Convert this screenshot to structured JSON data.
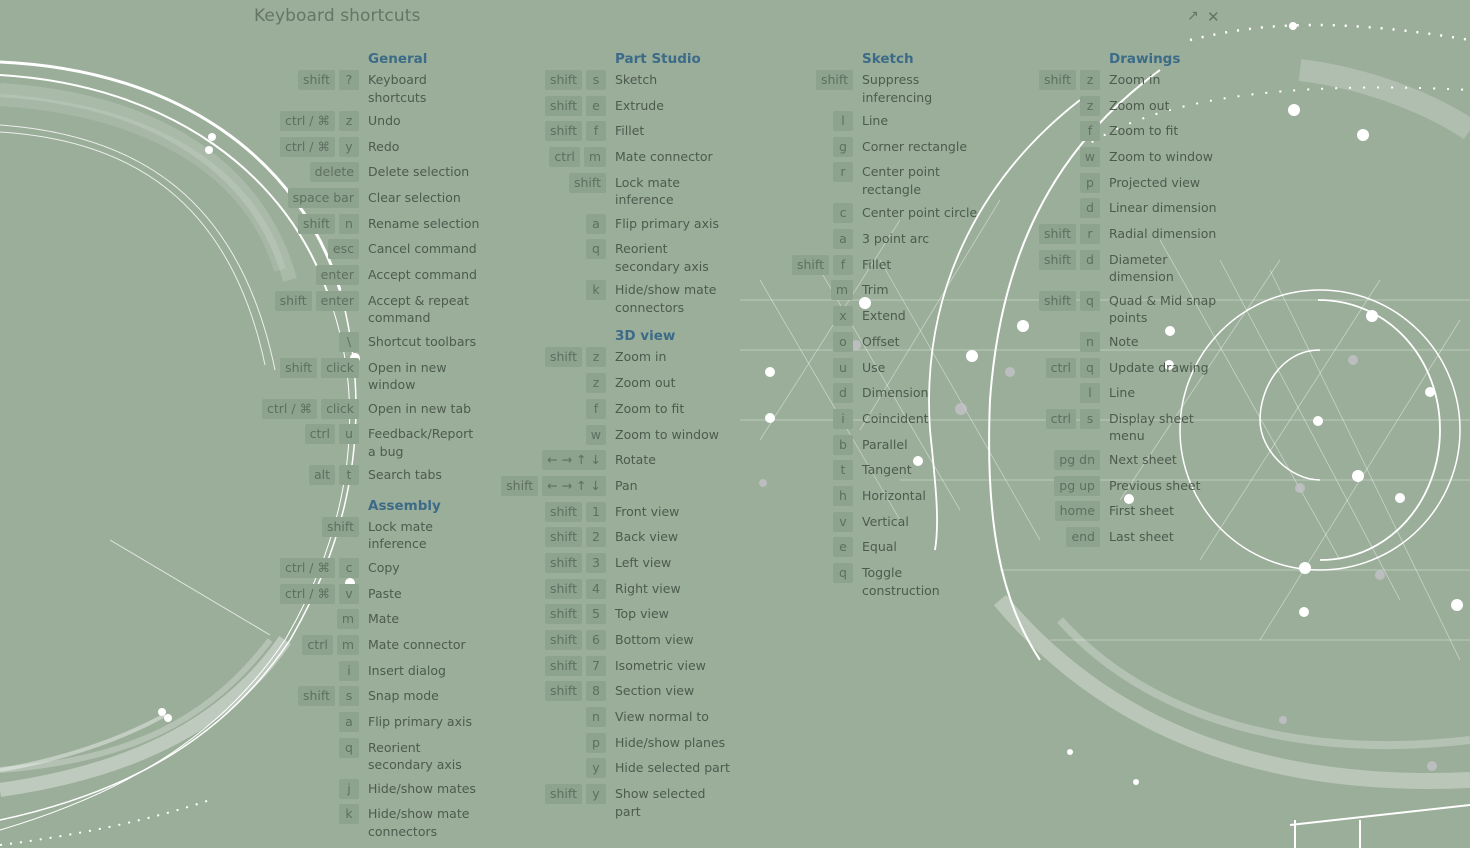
{
  "window": {
    "title": "Keyboard shortcuts",
    "expand_icon": "↗",
    "close_icon": "✕"
  },
  "colors": {
    "background": "#9bae9a",
    "section_title": "#3c6b88",
    "key_bg": "#8da38e",
    "text": "#4d5b4d"
  },
  "columns": [
    {
      "sections": [
        {
          "title": "General",
          "items": [
            {
              "keys": [
                "shift",
                "?"
              ],
              "label": "Keyboard shortcuts",
              "lines": 2
            },
            {
              "keys": [
                "ctrl / ⌘",
                "z"
              ],
              "label": "Undo"
            },
            {
              "keys": [
                "ctrl / ⌘",
                "y"
              ],
              "label": "Redo"
            },
            {
              "keys": [
                "delete"
              ],
              "label": "Delete selection"
            },
            {
              "keys": [
                "space bar"
              ],
              "label": "Clear selection"
            },
            {
              "keys": [
                "shift",
                "n"
              ],
              "label": "Rename selection"
            },
            {
              "keys": [
                "esc"
              ],
              "label": "Cancel command"
            },
            {
              "keys": [
                "enter"
              ],
              "label": "Accept command"
            },
            {
              "keys": [
                "shift",
                "enter"
              ],
              "label": "Accept & repeat command",
              "lines": 2
            },
            {
              "keys": [
                "\\"
              ],
              "label": "Shortcut toolbars"
            },
            {
              "keys": [
                "shift",
                "click"
              ],
              "label": "Open in new window",
              "lines": 2
            },
            {
              "keys": [
                "ctrl / ⌘",
                "click"
              ],
              "label": "Open in new tab"
            },
            {
              "keys": [
                "ctrl",
                "u"
              ],
              "label": "Feedback/Report a bug",
              "lines": 2
            },
            {
              "keys": [
                "alt",
                "t"
              ],
              "label": "Search tabs"
            }
          ]
        },
        {
          "title": "Assembly",
          "items": [
            {
              "keys": [
                "shift"
              ],
              "label": "Lock mate inference",
              "lines": 2
            },
            {
              "keys": [
                "ctrl / ⌘",
                "c"
              ],
              "label": "Copy"
            },
            {
              "keys": [
                "ctrl / ⌘",
                "v"
              ],
              "label": "Paste"
            },
            {
              "keys": [
                "m"
              ],
              "label": "Mate"
            },
            {
              "keys": [
                "ctrl",
                "m"
              ],
              "label": "Mate connector"
            },
            {
              "keys": [
                "i"
              ],
              "label": "Insert dialog"
            },
            {
              "keys": [
                "shift",
                "s"
              ],
              "label": "Snap mode"
            },
            {
              "keys": [
                "a"
              ],
              "label": "Flip primary axis"
            },
            {
              "keys": [
                "q"
              ],
              "label": "Reorient secondary axis",
              "lines": 2
            },
            {
              "keys": [
                "j"
              ],
              "label": "Hide/show mates"
            },
            {
              "keys": [
                "k"
              ],
              "label": "Hide/show mate connectors",
              "lines": 2
            }
          ]
        }
      ]
    },
    {
      "sections": [
        {
          "title": "Part Studio",
          "items": [
            {
              "keys": [
                "shift",
                "s"
              ],
              "label": "Sketch"
            },
            {
              "keys": [
                "shift",
                "e"
              ],
              "label": "Extrude"
            },
            {
              "keys": [
                "shift",
                "f"
              ],
              "label": "Fillet"
            },
            {
              "keys": [
                "ctrl",
                "m"
              ],
              "label": "Mate connector"
            },
            {
              "keys": [
                "shift"
              ],
              "label": "Lock mate inference",
              "lines": 2
            },
            {
              "keys": [
                "a"
              ],
              "label": "Flip primary axis"
            },
            {
              "keys": [
                "q"
              ],
              "label": "Reorient secondary axis",
              "lines": 2
            },
            {
              "keys": [
                "k"
              ],
              "label": "Hide/show mate connectors",
              "lines": 2
            }
          ]
        },
        {
          "title": "3D view",
          "items": [
            {
              "keys": [
                "shift",
                "z"
              ],
              "label": "Zoom in"
            },
            {
              "keys": [
                "z"
              ],
              "label": "Zoom out"
            },
            {
              "keys": [
                "f"
              ],
              "label": "Zoom to fit"
            },
            {
              "keys": [
                "w"
              ],
              "label": "Zoom to window"
            },
            {
              "keys": [
                "← → ↑ ↓"
              ],
              "label": "Rotate"
            },
            {
              "keys": [
                "shift",
                "← → ↑ ↓"
              ],
              "label": "Pan"
            },
            {
              "keys": [
                "shift",
                "1"
              ],
              "label": "Front view"
            },
            {
              "keys": [
                "shift",
                "2"
              ],
              "label": "Back view"
            },
            {
              "keys": [
                "shift",
                "3"
              ],
              "label": "Left view"
            },
            {
              "keys": [
                "shift",
                "4"
              ],
              "label": "Right view"
            },
            {
              "keys": [
                "shift",
                "5"
              ],
              "label": "Top view"
            },
            {
              "keys": [
                "shift",
                "6"
              ],
              "label": "Bottom view"
            },
            {
              "keys": [
                "shift",
                "7"
              ],
              "label": "Isometric view"
            },
            {
              "keys": [
                "shift",
                "8"
              ],
              "label": "Section view"
            },
            {
              "keys": [
                "n"
              ],
              "label": "View normal to"
            },
            {
              "keys": [
                "p"
              ],
              "label": "Hide/show planes"
            },
            {
              "keys": [
                "y"
              ],
              "label": "Hide selected part"
            },
            {
              "keys": [
                "shift",
                "y"
              ],
              "label": "Show selected part",
              "lines": 2
            }
          ]
        }
      ]
    },
    {
      "sections": [
        {
          "title": "Sketch",
          "items": [
            {
              "keys": [
                "shift"
              ],
              "label": "Suppress inferencing",
              "lines": 2
            },
            {
              "keys": [
                "l"
              ],
              "label": "Line"
            },
            {
              "keys": [
                "g"
              ],
              "label": "Corner rectangle"
            },
            {
              "keys": [
                "r"
              ],
              "label": "Center point rectangle",
              "lines": 2
            },
            {
              "keys": [
                "c"
              ],
              "label": "Center point circle"
            },
            {
              "keys": [
                "a"
              ],
              "label": "3 point arc"
            },
            {
              "keys": [
                "shift",
                "f"
              ],
              "label": "Fillet"
            },
            {
              "keys": [
                "m"
              ],
              "label": "Trim"
            },
            {
              "keys": [
                "x"
              ],
              "label": "Extend"
            },
            {
              "keys": [
                "o"
              ],
              "label": "Offset"
            },
            {
              "keys": [
                "u"
              ],
              "label": "Use"
            },
            {
              "keys": [
                "d"
              ],
              "label": "Dimension"
            },
            {
              "keys": [
                "i"
              ],
              "label": "Coincident"
            },
            {
              "keys": [
                "b"
              ],
              "label": "Parallel"
            },
            {
              "keys": [
                "t"
              ],
              "label": "Tangent"
            },
            {
              "keys": [
                "h"
              ],
              "label": "Horizontal"
            },
            {
              "keys": [
                "v"
              ],
              "label": "Vertical"
            },
            {
              "keys": [
                "e"
              ],
              "label": "Equal"
            },
            {
              "keys": [
                "q"
              ],
              "label": "Toggle construction",
              "lines": 2
            }
          ]
        }
      ]
    },
    {
      "sections": [
        {
          "title": "Drawings",
          "items": [
            {
              "keys": [
                "shift",
                "z"
              ],
              "label": "Zoom in"
            },
            {
              "keys": [
                "z"
              ],
              "label": "Zoom out"
            },
            {
              "keys": [
                "f"
              ],
              "label": "Zoom to fit"
            },
            {
              "keys": [
                "w"
              ],
              "label": "Zoom to window"
            },
            {
              "keys": [
                "p"
              ],
              "label": "Projected view"
            },
            {
              "keys": [
                "d"
              ],
              "label": "Linear dimension"
            },
            {
              "keys": [
                "shift",
                "r"
              ],
              "label": "Radial dimension"
            },
            {
              "keys": [
                "shift",
                "d"
              ],
              "label": "Diameter dimension",
              "lines": 2
            },
            {
              "keys": [
                "shift",
                "q"
              ],
              "label": "Quad & Mid snap points",
              "lines": 2
            },
            {
              "keys": [
                "n"
              ],
              "label": "Note"
            },
            {
              "keys": [
                "ctrl",
                "q"
              ],
              "label": "Update drawing"
            },
            {
              "keys": [
                "l"
              ],
              "label": "Line"
            },
            {
              "keys": [
                "ctrl",
                "s"
              ],
              "label": "Display sheet menu",
              "lines": 2
            },
            {
              "keys": [
                "pg dn"
              ],
              "label": "Next sheet"
            },
            {
              "keys": [
                "pg up"
              ],
              "label": "Previous sheet"
            },
            {
              "keys": [
                "home"
              ],
              "label": "First sheet"
            },
            {
              "keys": [
                "end"
              ],
              "label": "Last sheet"
            }
          ]
        }
      ]
    }
  ]
}
